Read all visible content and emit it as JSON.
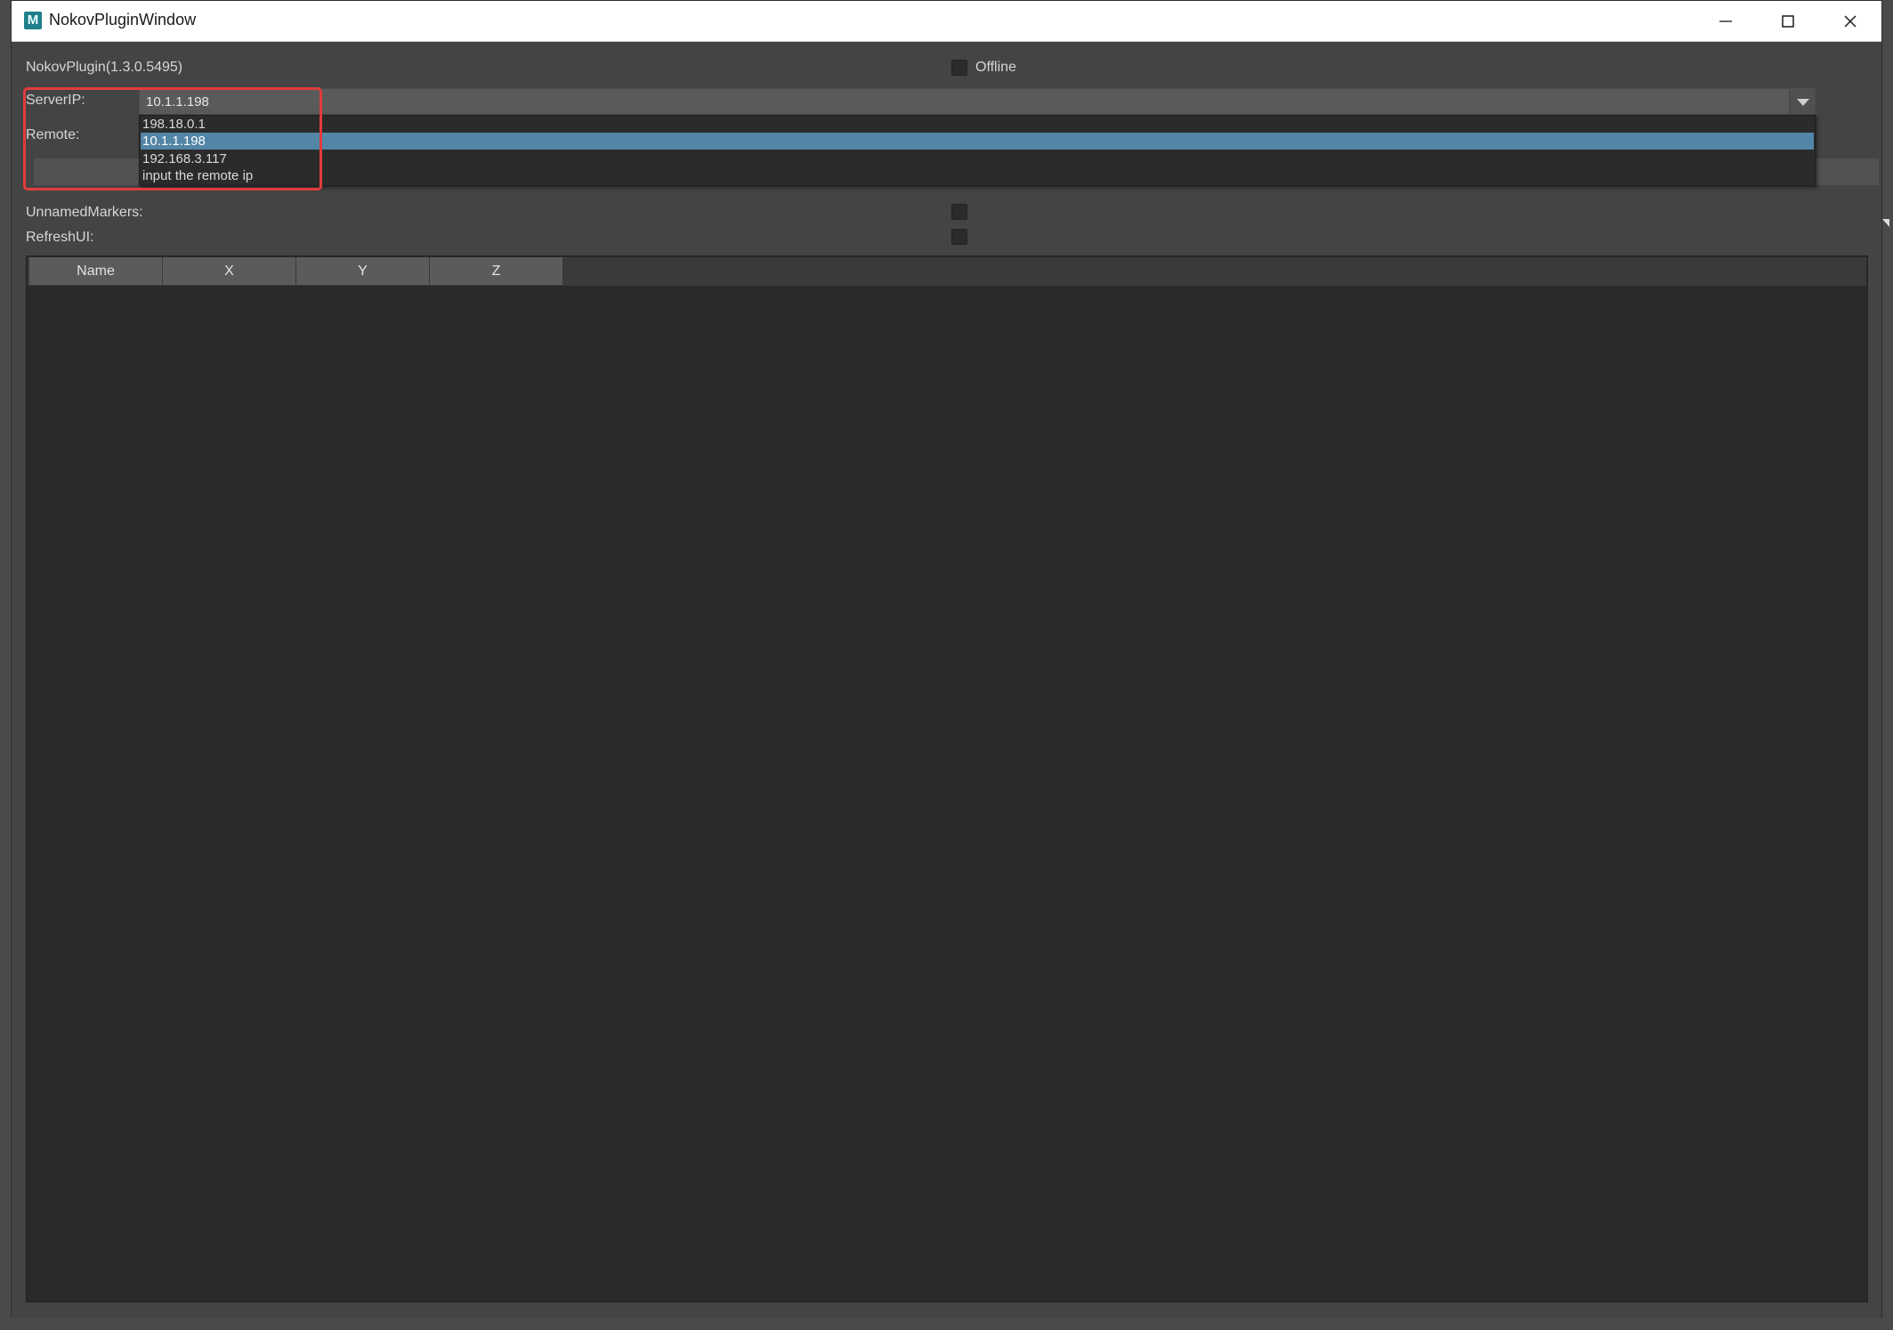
{
  "window": {
    "title": "NokovPluginWindow",
    "icon_letter": "M"
  },
  "plugin": {
    "version_label": "NokovPlugin(1.3.0.5495)",
    "offline_label": "Offline",
    "offline_checked": false
  },
  "server_ip": {
    "label": "ServerIP:",
    "selected_value": "10.1.1.198",
    "options": [
      "198.18.0.1",
      "10.1.1.198",
      "192.168.3.117",
      "input the remote ip"
    ],
    "selected_index": 1
  },
  "remote": {
    "label": "Remote:"
  },
  "unnamed_markers": {
    "label": "UnnamedMarkers:",
    "checked": false
  },
  "refresh_ui": {
    "label": "RefreshUI:",
    "checked": false
  },
  "table": {
    "columns": [
      "Name",
      "X",
      "Y",
      "Z"
    ],
    "rows": []
  },
  "colors": {
    "accent_selection": "#5285a6",
    "highlight_box": "#e23b3b",
    "panel_bg": "#444444",
    "table_bg": "#2a2a2a"
  }
}
